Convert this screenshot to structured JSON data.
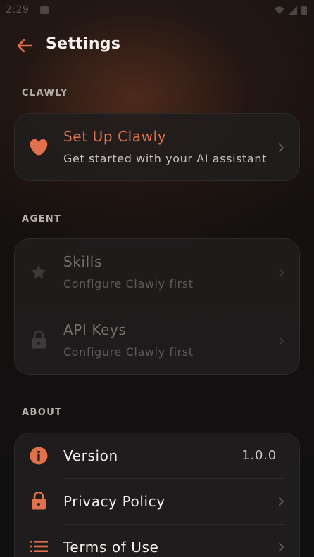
{
  "status_bar": {
    "time": "2:29"
  },
  "header": {
    "title": "Settings"
  },
  "sections": {
    "clawly": {
      "label": "CLAWLY",
      "setup": {
        "title": "Set Up Clawly",
        "subtitle": "Get started with your AI assistant"
      }
    },
    "agent": {
      "label": "AGENT",
      "skills": {
        "title": "Skills",
        "subtitle": "Configure Clawly first"
      },
      "api_keys": {
        "title": "API Keys",
        "subtitle": "Configure Clawly first"
      }
    },
    "about": {
      "label": "ABOUT",
      "version": {
        "title": "Version",
        "value": "1.0.0"
      },
      "privacy": {
        "title": "Privacy Policy"
      },
      "terms": {
        "title": "Terms of Use"
      }
    }
  },
  "colors": {
    "accent": "#e0714a",
    "background": "#121111",
    "card": "#201e1e"
  },
  "icons": [
    "back-arrow-icon",
    "heart-icon",
    "star-icon",
    "lock-icon",
    "info-icon",
    "list-icon",
    "chevron-right-icon"
  ]
}
